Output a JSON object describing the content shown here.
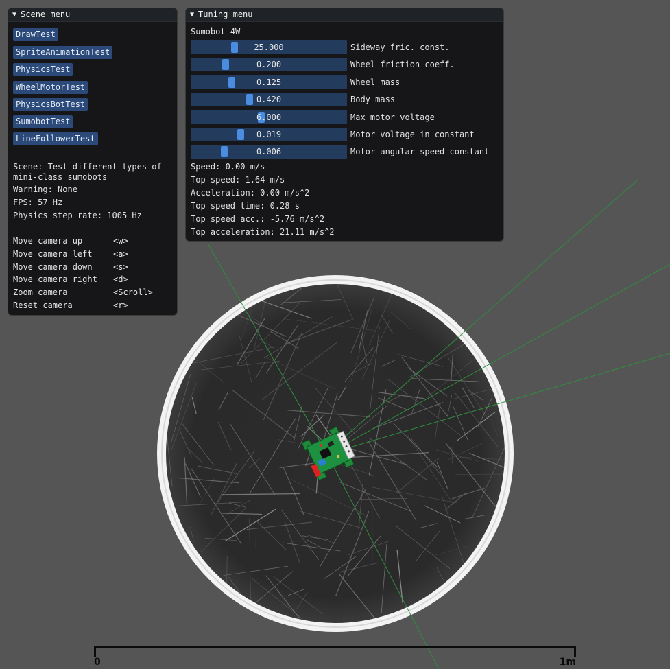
{
  "scene_menu": {
    "title": "Scene menu",
    "buttons": [
      {
        "label": "DrawTest"
      },
      {
        "label": "SpriteAnimationTest"
      },
      {
        "label": "PhysicsTest"
      },
      {
        "label": "WheelMotorTest"
      },
      {
        "label": "PhysicsBotTest"
      },
      {
        "label": "SumobotTest"
      },
      {
        "label": "LineFollowerTest"
      }
    ],
    "scene_line1": "Scene: Test different types of",
    "scene_line2": "mini-class sumobots",
    "warning": "Warning: None",
    "fps": "FPS: 57 Hz",
    "physics_rate": "Physics step rate: 1005 Hz",
    "controls": [
      {
        "action": "Move camera up",
        "key": "<w>"
      },
      {
        "action": "Move camera left",
        "key": "<a>"
      },
      {
        "action": "Move camera down",
        "key": "<s>"
      },
      {
        "action": "Move camera right",
        "key": "<d>"
      },
      {
        "action": "Zoom camera",
        "key": "<Scroll>"
      },
      {
        "action": "Reset camera",
        "key": "<r>"
      }
    ]
  },
  "tuning_menu": {
    "title": "Tuning menu",
    "subtitle": "Sumobot 4W",
    "sliders": [
      {
        "value": "25.000",
        "label": "Sideway fric. const.",
        "level": 0.27
      },
      {
        "value": "0.200",
        "label": "Wheel friction coeff.",
        "level": 0.21
      },
      {
        "value": "0.125",
        "label": "Wheel mass",
        "level": 0.25
      },
      {
        "value": "0.420",
        "label": "Body mass",
        "level": 0.37
      },
      {
        "value": "6.000",
        "label": "Max motor voltage",
        "level": 0.45
      },
      {
        "value": "0.019",
        "label": "Motor voltage in constant",
        "level": 0.31
      },
      {
        "value": "0.006",
        "label": "Motor angular speed constant",
        "level": 0.2
      }
    ],
    "stats": [
      "Speed: 0.00 m/s",
      "Top speed: 1.64 m/s",
      "Acceleration: 0.00 m/s^2",
      "Top speed time: 0.28 s",
      "Top speed acc.: -5.76 m/s^2",
      "Top acceleration: 21.11 m/s^2"
    ]
  },
  "scale_bar": {
    "start_label": "0",
    "end_label": "1m"
  },
  "colors": {
    "background": "#555555",
    "panel": "#121214",
    "button": "#2b4a7a",
    "slider_track": "#233b5c",
    "slider_grab": "#4a8de0",
    "ring": "#f4f4f4",
    "arena": "#2b2b2b",
    "sensor_ray": "#2e8b3e",
    "robot_board": "#1f8a3a"
  }
}
